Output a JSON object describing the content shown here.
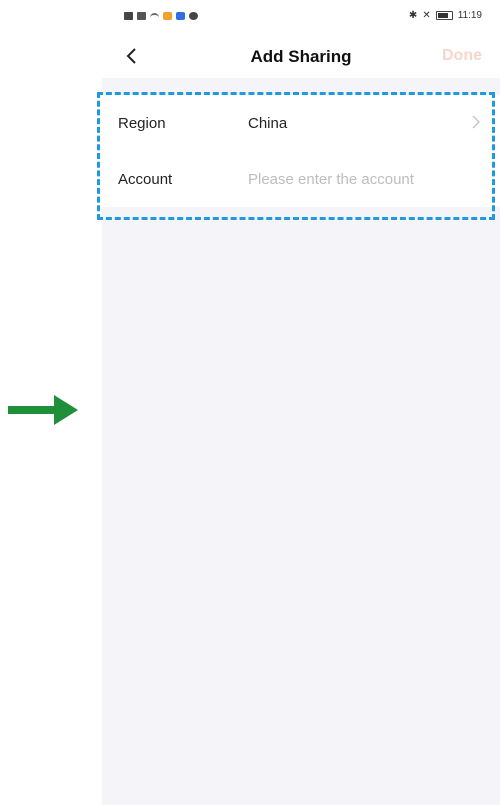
{
  "status_bar": {
    "time": "11:19"
  },
  "header": {
    "title": "Add Sharing",
    "done_label": "Done"
  },
  "form": {
    "region": {
      "label": "Region",
      "value": "China"
    },
    "account": {
      "label": "Account",
      "placeholder": "Please enter the account",
      "value": ""
    }
  },
  "colors": {
    "dash_highlight": "#1e9be0",
    "arrow": "#1f8f3a",
    "done_disabled": "#f6d6cc",
    "page_bg": "#f4f4f9"
  },
  "icons": {
    "back": "chevron-left-icon",
    "region_chevron": "chevron-right-icon",
    "pointer_arrow": "arrow-right-icon"
  }
}
